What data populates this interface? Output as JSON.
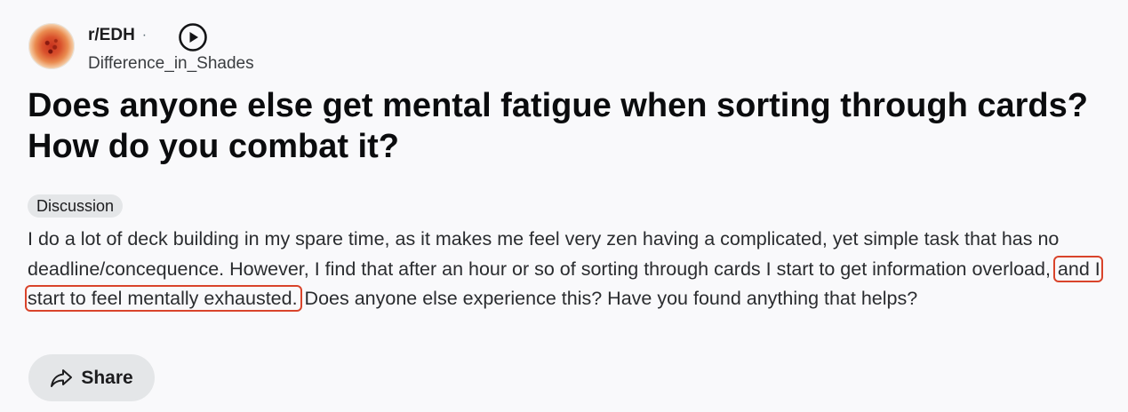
{
  "post": {
    "subreddit": "r/EDH",
    "separator": "·",
    "author": "Difference_in_Shades",
    "title_line1": "Does anyone else get mental fatigue when sorting through cards?",
    "title_line2": "How do you combat it?",
    "flair": "Discussion",
    "body_before": "I do a lot of deck building in my spare time, as it makes me feel very zen having a complicated, yet simple task that has no deadline/concequence. However, I find that after an hour or so of sorting through cards I start to get information overload, ",
    "body_highlight": "and I start to feel mentally exhausted.",
    "body_after": " Does anyone else experience this? Have you found anything that helps?"
  },
  "actions": {
    "share_label": "Share"
  },
  "icons": {
    "play": "play-circle-icon",
    "share": "share-arrow-icon",
    "avatar": "subreddit-avatar"
  },
  "colors": {
    "highlight_outline": "#d9442b",
    "flair_bg": "#e4e6e8",
    "button_bg": "#e4e6e8",
    "page_bg": "#f9f9fb"
  }
}
